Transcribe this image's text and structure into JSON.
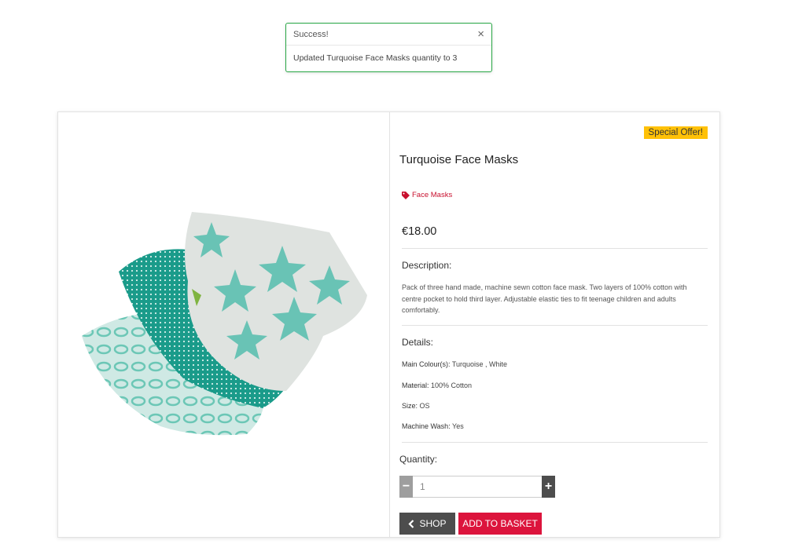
{
  "toast": {
    "title": "Success!",
    "close_symbol": "×",
    "message": "Updated Turquoise Face Masks quantity to 3",
    "border_color": "#28a745"
  },
  "product": {
    "badge": "Special Offer!",
    "name": "Turquoise Face Masks",
    "category": "Face Masks",
    "category_icon": "tag-icon",
    "price": "€18.00",
    "description_label": "Description:",
    "description": "Pack of three hand made, machine sewn cotton face mask. Two layers of 100% cotton with centre pocket to hold third layer. Adjustable elastic ties to fit teenage children and adults comfortably.",
    "details_label": "Details:",
    "details": {
      "colour_label": "Main Colour(s):",
      "colour_value": "Turquoise , White",
      "material_label": "Material:",
      "material_value": "100% Cotton",
      "size_label": "Size:",
      "size_value": "OS",
      "wash_label": "Machine Wash:",
      "wash_value": "Yes"
    }
  },
  "quantity": {
    "label": "Quantity:",
    "value": "1",
    "minus_symbol": "−",
    "plus_symbol": "+"
  },
  "actions": {
    "shop_label": "SHOP",
    "basket_label": "ADD TO BASKET"
  },
  "colors": {
    "accent": "#dc143c",
    "badge": "#ffc107",
    "dark_button": "#4d4d4d"
  }
}
